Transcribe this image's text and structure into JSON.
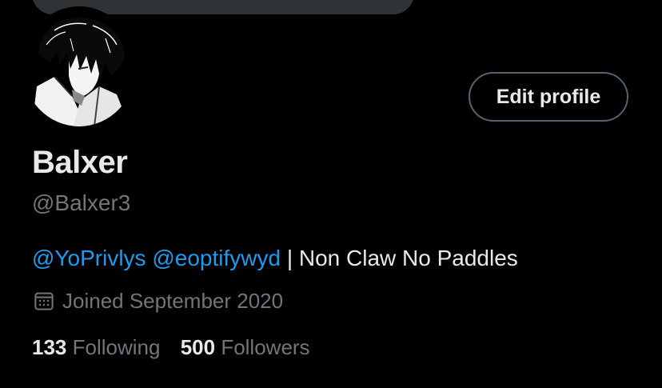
{
  "profile": {
    "display_name": "Balxer",
    "handle": "@Balxer3",
    "edit_button_label": "Edit profile",
    "bio": {
      "mention_1": "@YoPrivlys",
      "mention_2": "@eoptifywyd",
      "text": " | Non Claw No Paddles"
    },
    "joined": {
      "icon": "calendar-icon",
      "text": "Joined September 2020"
    },
    "stats": {
      "following_count": "133",
      "following_label": "Following",
      "followers_count": "500",
      "followers_label": "Followers"
    }
  },
  "colors": {
    "background": "#000000",
    "primary_text": "#e7e9ea",
    "secondary_text": "#71767b",
    "link": "#1d9bf0",
    "button_border": "#536471",
    "banner": "#2f3336"
  }
}
